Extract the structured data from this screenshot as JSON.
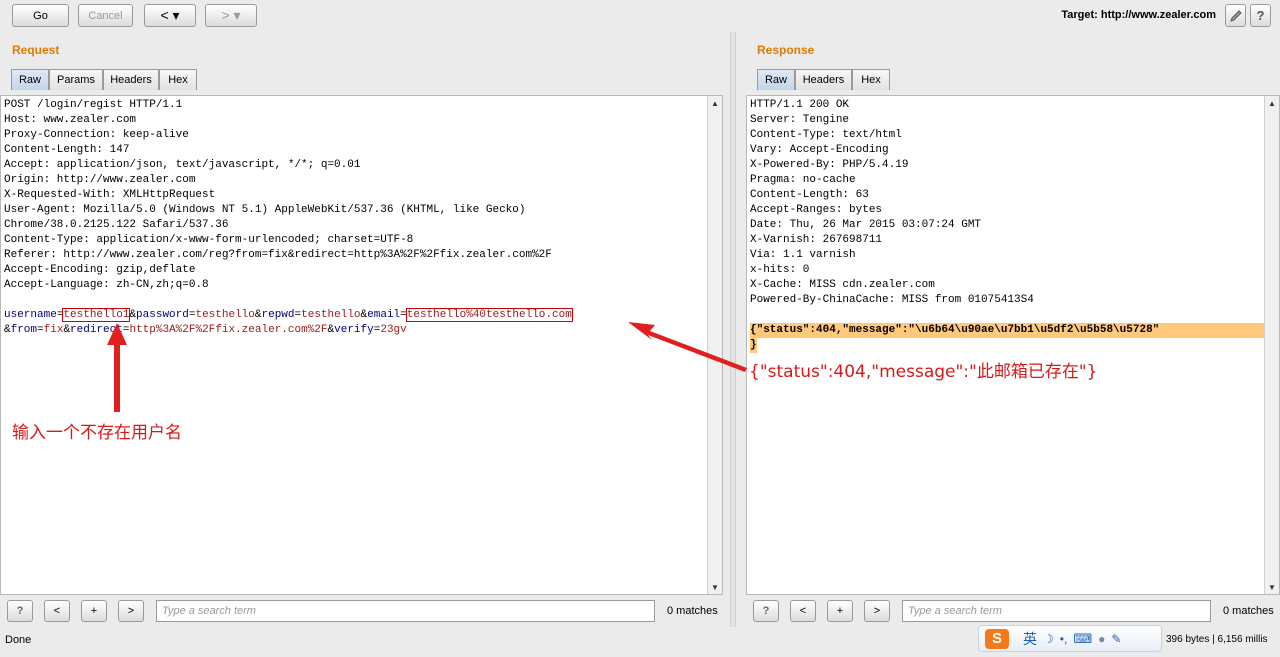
{
  "toolbar": {
    "go_label": "Go",
    "cancel_label": "Cancel",
    "back_label": "< ▾",
    "forward_label": "> ▾",
    "target_label": "Target: http://www.zealer.com"
  },
  "request": {
    "title": "Request",
    "tabs": [
      "Raw",
      "Params",
      "Headers",
      "Hex"
    ],
    "headers": [
      "POST /login/regist HTTP/1.1",
      "Host: www.zealer.com",
      "Proxy-Connection: keep-alive",
      "Content-Length: 147",
      "Accept: application/json, text/javascript, */*; q=0.01",
      "Origin: http://www.zealer.com",
      "X-Requested-With: XMLHttpRequest",
      "User-Agent: Mozilla/5.0 (Windows NT 5.1) AppleWebKit/537.36 (KHTML, like Gecko)",
      "Chrome/38.0.2125.122 Safari/537.36",
      "Content-Type: application/x-www-form-urlencoded; charset=UTF-8",
      "Referer: http://www.zealer.com/reg?from=fix&redirect=http%3A%2F%2Ffix.zealer.com%2F",
      "Accept-Encoding: gzip,deflate",
      "Accept-Language: zh-CN,zh;q=0.8"
    ],
    "body": {
      "username_key": "username",
      "username_val": "testhello1",
      "password_key": "password",
      "password_val": "testhello",
      "repwd_key": "repwd",
      "repwd_val": "testhello",
      "email_key": "email",
      "email_val": "testhello%40testhello.com",
      "from_key": "from",
      "from_val": "fix",
      "redirect_key": "redirect",
      "redirect_val": "http%3A%2F%2Ffix.zealer.com%2F",
      "verify_key": "verify",
      "verify_val": "23gv"
    },
    "search_placeholder": "Type a search term",
    "matches": "0 matches"
  },
  "response": {
    "title": "Response",
    "tabs": [
      "Raw",
      "Headers",
      "Hex"
    ],
    "headers": [
      "HTTP/1.1 200 OK",
      "Server: Tengine",
      "Content-Type: text/html",
      "Vary: Accept-Encoding",
      "X-Powered-By: PHP/5.4.19",
      "Pragma: no-cache",
      "Content-Length: 63",
      "Accept-Ranges: bytes",
      "Date: Thu, 26 Mar 2015 03:07:24 GMT",
      "X-Varnish: 267698711",
      "Via: 1.1 varnish",
      "x-hits: 0",
      "X-Cache: MISS cdn.zealer.com",
      "Powered-By-ChinaCache: MISS from 01075413S4"
    ],
    "body_line1": "{\"status\":404,\"message\":\"\\u6b64\\u90ae\\u7bb1\\u5df2\\u5b58\\u5728\"",
    "body_line2": "}",
    "search_placeholder": "Type a search term",
    "matches": "0 matches"
  },
  "annotations": {
    "left_note": "输入一个不存在用户名",
    "right_note": "{\"status\":404,\"message\":\"此邮箱已存在\"}"
  },
  "statusbar": {
    "status_text": "Done",
    "info_text": "396 bytes | 6,156 millis",
    "ime_lang": "英"
  },
  "search_buttons": {
    "help": "?",
    "prev": "<",
    "add": "+",
    "next": ">"
  }
}
